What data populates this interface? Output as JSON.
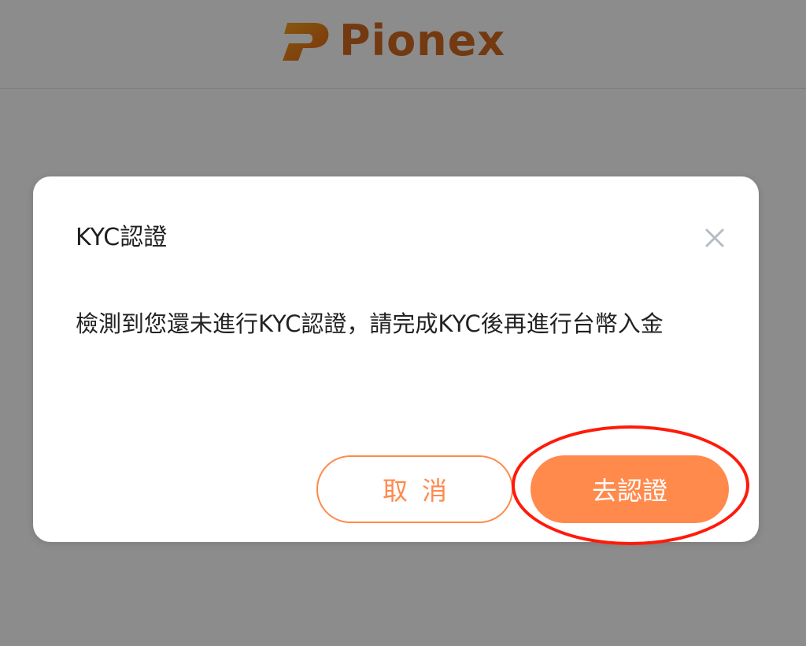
{
  "header": {
    "logo_text": "Pionex"
  },
  "dialog": {
    "title": "KYC認證",
    "message": "檢測到您還未進行KYC認證，請完成KYC後再進行台幣入金",
    "cancel_label": "取消",
    "confirm_label": "去認證"
  },
  "colors": {
    "accent": "#ff8a4c",
    "brand": "#d2691e",
    "highlight": "#ff1a0a",
    "overlay": "rgba(0,0,0,0.45)"
  },
  "icons": {
    "close": "close-icon",
    "logo": "pionex-logo-icon"
  }
}
